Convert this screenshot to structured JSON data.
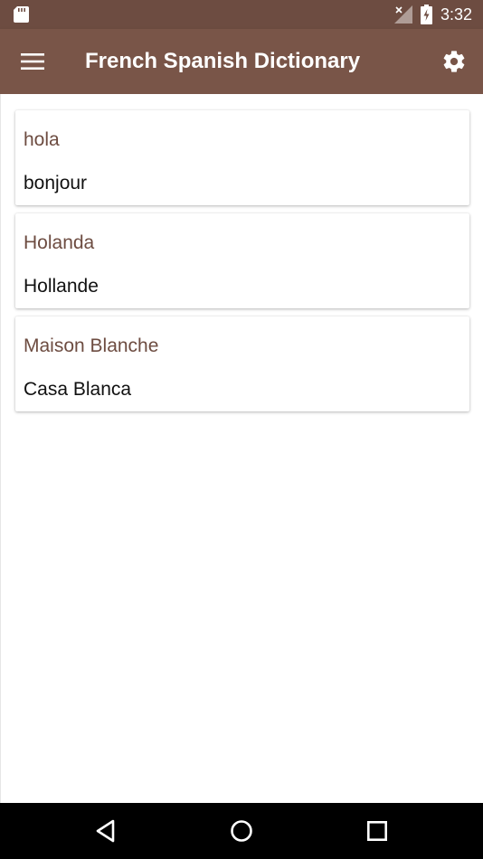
{
  "status_bar": {
    "time": "3:32",
    "icons": [
      "sd-card-icon",
      "signal-off-icon",
      "battery-charging-icon"
    ]
  },
  "app_bar": {
    "title": "French Spanish Dictionary",
    "menu_icon": "menu-icon",
    "settings_icon": "gear-icon"
  },
  "results": [
    {
      "term": "hola",
      "translation": "bonjour"
    },
    {
      "term": "Holanda",
      "translation": "Hollande"
    },
    {
      "term": "Maison Blanche",
      "translation": "Casa Blanca"
    }
  ],
  "nav_bar": {
    "icons": [
      "back-icon",
      "home-icon",
      "recents-icon"
    ]
  },
  "colors": {
    "status_bar": "#6d4c41",
    "app_bar": "#795548",
    "term_text": "#6d4c41",
    "translation_text": "#111111",
    "nav_bar": "#000000"
  }
}
